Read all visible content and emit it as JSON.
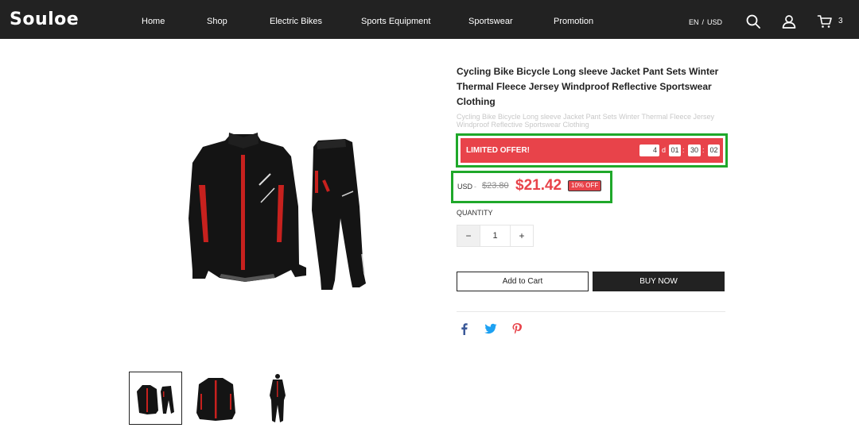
{
  "header": {
    "logo": "Souloe",
    "nav": [
      {
        "label": "Home"
      },
      {
        "label": "Shop"
      },
      {
        "label": "Electric Bikes"
      },
      {
        "label": "Sports Equipment"
      },
      {
        "label": "Sportswear"
      },
      {
        "label": "Promotion"
      }
    ],
    "language": "EN",
    "currency": "USD",
    "locale_separator": "/",
    "cart_count": "3",
    "icons": [
      "search-icon",
      "user-icon",
      "cart-icon"
    ]
  },
  "product": {
    "title": "Cycling Bike Bicycle Long sleeve Jacket Pant Sets Winter Thermal Fleece Jersey Windproof Reflective Sportswear Clothing",
    "subtitle": "Cycling Bike Bicycle Long sleeve Jacket Pant Sets Winter Thermal Fleece Jersey Windproof Reflective Sportswear Clothing",
    "offer": {
      "label": "LIMITED OFFER!",
      "days": "4",
      "days_unit": "d",
      "hours": "01",
      "minutes": "30",
      "seconds": "02",
      "separator": ":"
    },
    "price": {
      "currency": "USD",
      "dash": "-",
      "original": "$23.80",
      "current": "$21.42",
      "discount": "10% OFF"
    },
    "quantity": {
      "label": "QUANTITY",
      "value": "1",
      "minus": "−",
      "plus": "+"
    },
    "buttons": {
      "add_to_cart": "Add to Cart",
      "buy_now": "BUY NOW"
    },
    "share_icons": [
      "facebook-icon",
      "twitter-icon",
      "pinterest-icon"
    ],
    "thumbnails": [
      "jacket-and-pants-set",
      "jacket",
      "model-wearing-set"
    ]
  },
  "colors": {
    "header_bg": "#222222",
    "accent_red": "#e8434a",
    "highlight_green": "#1fa82a",
    "facebook": "#3b5998",
    "twitter": "#1da1f2",
    "pinterest": "#e8434a"
  }
}
